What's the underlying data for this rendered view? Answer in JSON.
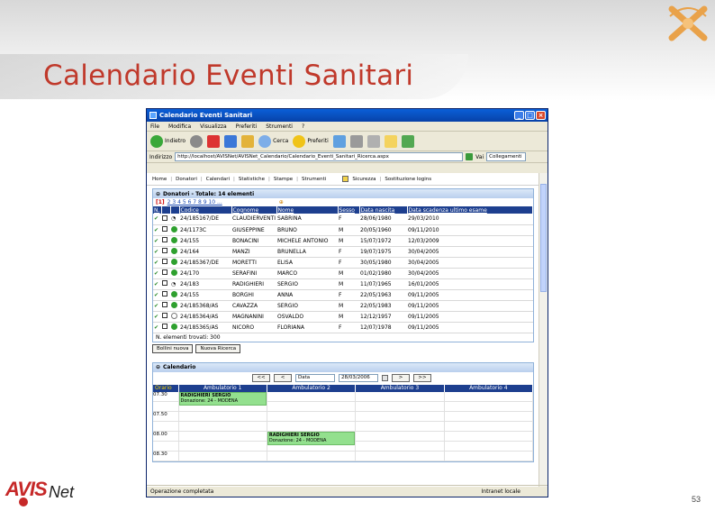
{
  "slide": {
    "title": "Calendario Eventi Sanitari",
    "page_number": "53",
    "logo_main": "AVIS",
    "logo_suffix": "Net"
  },
  "window": {
    "title": "Calendario Eventi Sanitari",
    "menu": [
      "File",
      "Modifica",
      "Visualizza",
      "Preferiti",
      "Strumenti",
      "?"
    ],
    "toolbar": {
      "back_label": "Indietro",
      "search_label": "Cerca",
      "favorites_label": "Preferiti"
    },
    "address_label": "Indirizzo",
    "address_value": "http://localhost/AVISNet/AVISNet_Calendario/Calendario_Eventi_Sanitari_Ricerca.aspx",
    "go_label": "Vai",
    "search_placeholder": "Collegamenti",
    "status_text": "Operazione completata",
    "status_zone": "Intranet locale"
  },
  "app_nav": {
    "items": [
      "Home",
      "Donatori",
      "Calendari",
      "Statistiche",
      "Stampe",
      "Strumenti",
      "Sicurezza",
      "Sostituzione logins"
    ]
  },
  "donors_panel": {
    "title": "Donatori - Totale: 14 elementi",
    "pager_prefix": "[1]",
    "pages": "2 3 4 5 6 7 8 9 10 ...",
    "columns": [
      "N.",
      "Codice",
      "Cognome",
      "Nome",
      "Sesso",
      "Data nascita",
      "Data scadenza ultimo esame"
    ],
    "rows": [
      {
        "status": "none",
        "codice": "24/185167/DE",
        "cognome": "CLAUDIERVENTI",
        "nome": "SABRINA",
        "sesso": "F",
        "nascita": "28/06/1980",
        "scadenza": "29/03/2010"
      },
      {
        "status": "ok",
        "codice": "24/1173C",
        "cognome": "GIUSEPPINE",
        "nome": "BRUNO",
        "sesso": "M",
        "nascita": "20/05/1960",
        "scadenza": "09/11/2010"
      },
      {
        "status": "ok",
        "codice": "24/155",
        "cognome": "BONACINI",
        "nome": "MICHELE ANTONIO",
        "sesso": "M",
        "nascita": "15/07/1972",
        "scadenza": "12/03/2009"
      },
      {
        "status": "ok",
        "codice": "24/164",
        "cognome": "MANZI",
        "nome": "BRUNELLA",
        "sesso": "F",
        "nascita": "19/07/1975",
        "scadenza": "30/04/2005"
      },
      {
        "status": "ok",
        "codice": "24/185367/DE",
        "cognome": "MORETTI",
        "nome": "ELISA",
        "sesso": "F",
        "nascita": "30/05/1980",
        "scadenza": "30/04/2005"
      },
      {
        "status": "ok",
        "codice": "24/170",
        "cognome": "SERAFINI",
        "nome": "MARCO",
        "sesso": "M",
        "nascita": "01/02/1980",
        "scadenza": "30/04/2005"
      },
      {
        "status": "none",
        "codice": "24/183",
        "cognome": "RADIGHIERI",
        "nome": "SERGIO",
        "sesso": "M",
        "nascita": "11/07/1965",
        "scadenza": "16/01/2005"
      },
      {
        "status": "ok",
        "codice": "24/155",
        "cognome": "BORGHI",
        "nome": "ANNA",
        "sesso": "F",
        "nascita": "22/05/1963",
        "scadenza": "09/11/2005"
      },
      {
        "status": "ok",
        "codice": "24/185368/AS",
        "cognome": "CAVAZZA",
        "nome": "SERGIO",
        "sesso": "M",
        "nascita": "22/05/1983",
        "scadenza": "09/11/2005"
      },
      {
        "status": "empty",
        "codice": "24/185364/AS",
        "cognome": "MAGNANINI",
        "nome": "OSVALDO",
        "sesso": "M",
        "nascita": "12/12/1957",
        "scadenza": "09/11/2005"
      },
      {
        "status": "ok",
        "codice": "24/185365/AS",
        "cognome": "NICORO",
        "nome": "FLORIANA",
        "sesso": "F",
        "nascita": "12/07/1978",
        "scadenza": "09/11/2005"
      }
    ],
    "count_text": "N. elementi trovati: 300",
    "buttons": [
      "Bollini nuova",
      "Nuova Ricerca"
    ]
  },
  "calendar_panel": {
    "title": "Calendario",
    "prev_fast": "<<",
    "prev": "<",
    "date_label": "Data",
    "date_value": "28/03/2006",
    "next": ">",
    "next_fast": ">>",
    "columns": [
      "Orario",
      "Ambulatorio 1",
      "Ambulatorio 2",
      "Ambulatorio 3",
      "Ambulatorio 4"
    ],
    "times": [
      "07.30",
      "",
      "07.50",
      "",
      "08.00",
      "",
      "08.30"
    ],
    "appointments": [
      {
        "name": "RADIGHIERI SERGIO",
        "detail": "Donazione: 24 - MODENA"
      },
      {
        "name": "RADIGHIERI SERGIO",
        "detail": "Donazione: 24 - MODENA"
      }
    ]
  }
}
